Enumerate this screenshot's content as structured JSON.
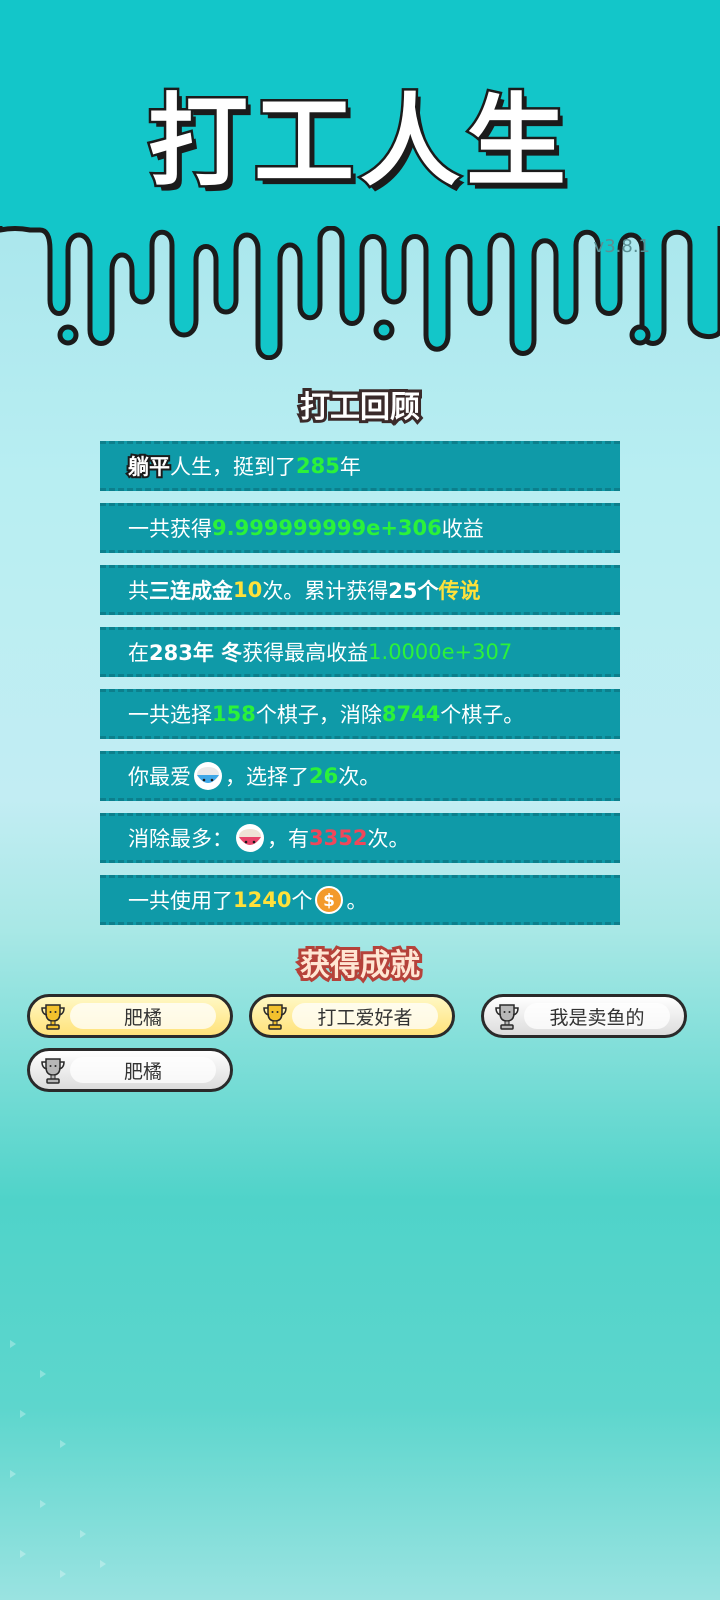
{
  "header": {
    "title": "打工人生",
    "version": "v3.8.1"
  },
  "review": {
    "title": "打工回顾",
    "row1": {
      "a": "躺平",
      "b": "人生，挺到了",
      "c": "285",
      "d": "年"
    },
    "row2": {
      "a": "一共获得",
      "b": "9.999999999e+306",
      "c": "收益"
    },
    "row3": {
      "a": "共",
      "b": "三连成金",
      "c": "10",
      "d": "次。累计获得",
      "e": "25个",
      "f": "传说"
    },
    "row4": {
      "a": "在 ",
      "b": "283年 冬",
      "c": " 获得最高收益",
      "d": "1.0000e+307"
    },
    "row5": {
      "a": "一共选择",
      "b": "158",
      "c": "个棋子，消除",
      "d": "8744",
      "e": "个棋子。"
    },
    "row6": {
      "a": "你最爱",
      "icon": "rice-bowl-blue-icon",
      "b": "，选择了",
      "c": "26",
      "d": "次。"
    },
    "row7": {
      "a": "消除最多：",
      "icon": "rice-bowl-pink-icon",
      "b": "，有",
      "c": "3352",
      "d": "次。"
    },
    "row8": {
      "a": "一共使用了",
      "b": "1240",
      "c": "个",
      "icon": "coin-icon",
      "d": "。"
    }
  },
  "achievements": {
    "title": "获得成就",
    "items": [
      {
        "label": "肥橘",
        "tier": "gold"
      },
      {
        "label": "打工爱好者",
        "tier": "gold"
      },
      {
        "label": "我是卖鱼的",
        "tier": "silver"
      },
      {
        "label": "肥橘",
        "tier": "silver"
      }
    ]
  },
  "colors": {
    "accent": "#13c6c9",
    "row_bg": "#0f9aa8",
    "highlight_green": "#2bf23a",
    "highlight_yellow": "#ffe13a",
    "highlight_red": "#f0475a"
  }
}
